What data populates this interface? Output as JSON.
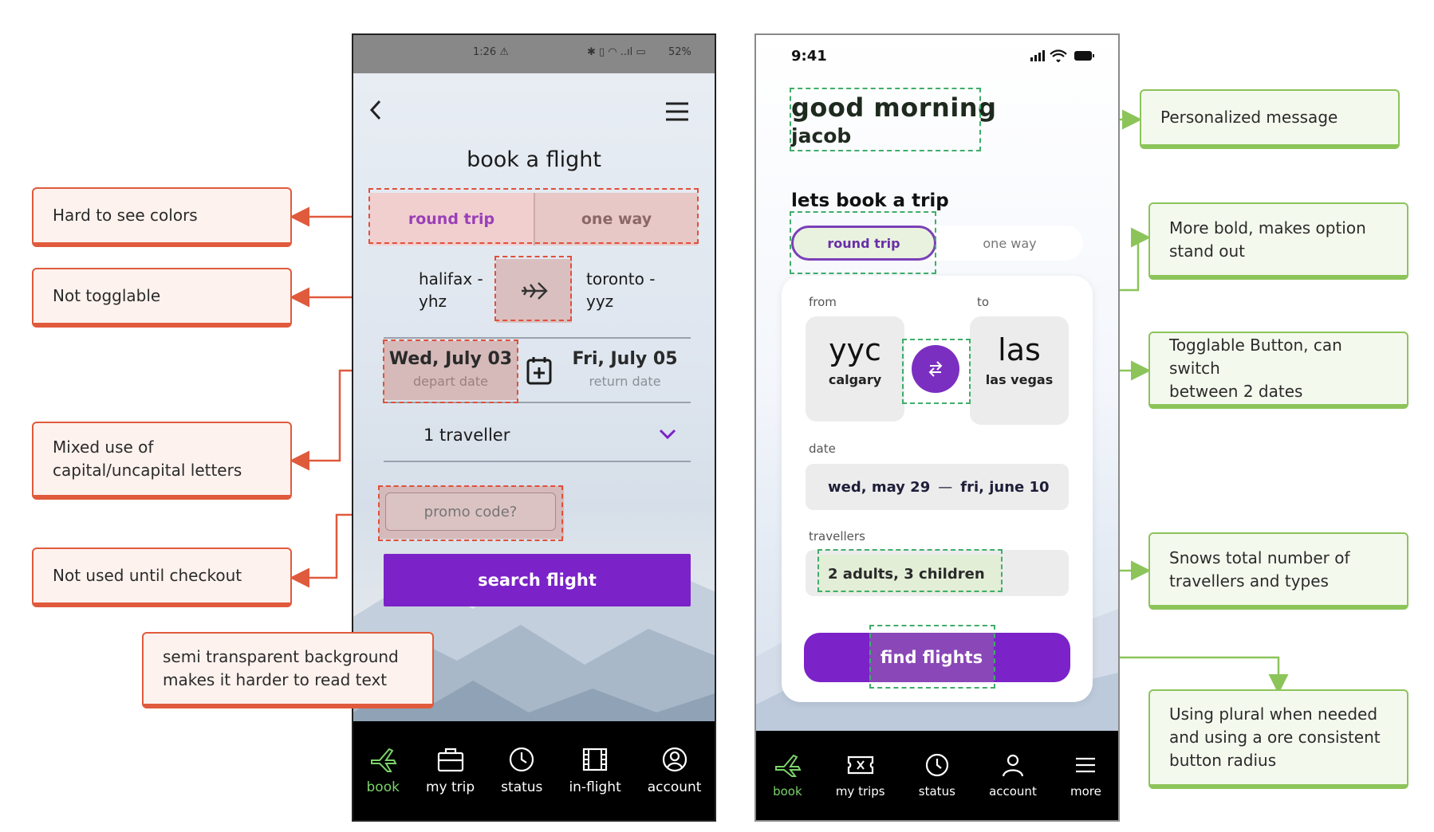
{
  "colors": {
    "annotation_red": "#e05a3c",
    "annotation_green": "#8cc45a",
    "brand_purple": "#7b22c9",
    "tab_active_green": "#7bd36a"
  },
  "annotations": {
    "left": [
      "Hard to see colors",
      "Not togglable",
      "Mixed use of\ncapital/uncapital letters",
      "Not used until checkout",
      "semi transparent background\nmakes it harder to read text"
    ],
    "right": [
      "Personalized message",
      "More bold, makes option\nstand out",
      "Togglable Button, can switch\nbetween 2 dates",
      "Snows total number of\ntravellers and types",
      "Using plural when needed\nand using a ore consistent\nbutton radius"
    ]
  },
  "old_app": {
    "status": {
      "time": "1:26 ⚠",
      "right": "52%"
    },
    "header_icons": [
      "back-chevron-icon",
      "hamburger-menu-icon"
    ],
    "title": "book a flight",
    "trip_types": [
      "round trip",
      "one way"
    ],
    "from": "halifax -\nyhz",
    "to": "toronto -\nyyz",
    "swap_icon": "airplane-icon",
    "depart_date": "Wed, July 03",
    "depart_label": "depart date",
    "return_date": "Fri, July 05",
    "return_label": "return date",
    "travellers": "1 traveller",
    "promo_placeholder": "promo code?",
    "search_button": "search flight",
    "tabs": [
      {
        "label": "book",
        "icon": "plane-icon",
        "active": true
      },
      {
        "label": "my trip",
        "icon": "briefcase-icon",
        "active": false
      },
      {
        "label": "status",
        "icon": "clock-icon",
        "active": false
      },
      {
        "label": "in-flight",
        "icon": "film-icon",
        "active": false
      },
      {
        "label": "account",
        "icon": "user-circle-icon",
        "active": false
      }
    ]
  },
  "new_app": {
    "status": {
      "time": "9:41"
    },
    "greeting_line1": "good morning",
    "greeting_line2": "jacob",
    "section_title": "lets book a trip",
    "trip_types": [
      "round trip",
      "one way"
    ],
    "from_label": "from",
    "to_label": "to",
    "from_code": "yyc",
    "from_city": "calgary",
    "to_code": "las",
    "to_city": "las vegas",
    "swap_icon": "swap-arrows-icon",
    "date_label": "date",
    "date_start": "wed, may 29",
    "date_sep": "—",
    "date_end": "fri, june 10",
    "travellers_label": "travellers",
    "travellers_value": "2 adults, 3 children",
    "find_button": "find flights",
    "tabs": [
      {
        "label": "book",
        "icon": "plane-icon",
        "active": true
      },
      {
        "label": "my trips",
        "icon": "ticket-icon",
        "active": false
      },
      {
        "label": "status",
        "icon": "clock-icon",
        "active": false
      },
      {
        "label": "account",
        "icon": "user-icon",
        "active": false
      },
      {
        "label": "more",
        "icon": "menu-icon",
        "active": false
      }
    ]
  }
}
